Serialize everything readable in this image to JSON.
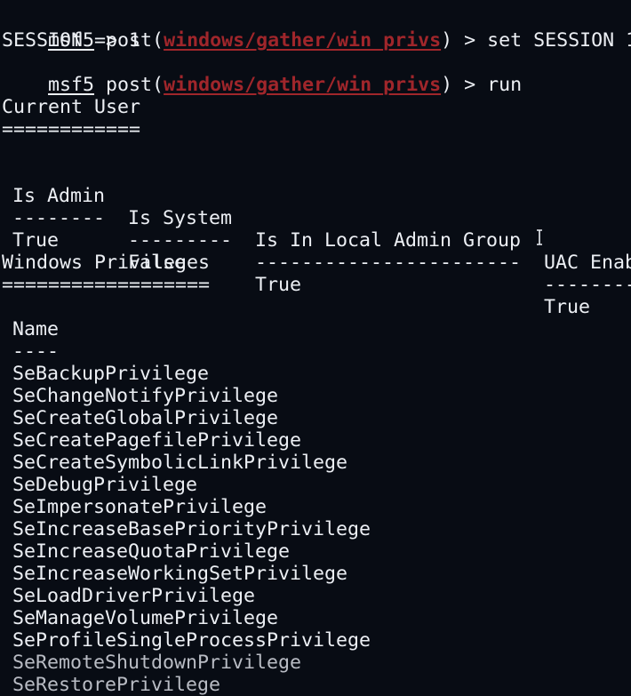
{
  "prompt": "msf5",
  "module_prefix": "post(",
  "module": "windows/gather/win_privs",
  "module_suffix": ")",
  "cmd1": " > set SESSION 1",
  "out1": "SESSION => 1",
  "cmd2": " > run",
  "current_user_title": "Current User",
  "current_user_rule": "============",
  "user_table": {
    "headers": [
      "Is Admin",
      "Is System",
      "Is In Local Admin Group",
      "UAC Enab"
    ],
    "separators": [
      "--------",
      "---------",
      "-----------------------",
      "--------"
    ],
    "row": [
      "True",
      "False",
      "True",
      "True"
    ]
  },
  "priv_title": "Windows Privileges",
  "priv_rule": "==================",
  "priv_header": "Name",
  "priv_sep": "----",
  "privileges": [
    "SeBackupPrivilege",
    "SeChangeNotifyPrivilege",
    "SeCreateGlobalPrivilege",
    "SeCreatePagefilePrivilege",
    "SeCreateSymbolicLinkPrivilege",
    "SeDebugPrivilege",
    "SeImpersonatePrivilege",
    "SeIncreaseBasePriorityPrivilege",
    "SeIncreaseQuotaPrivilege",
    "SeIncreaseWorkingSetPrivilege",
    "SeLoadDriverPrivilege",
    "SeManageVolumePrivilege",
    "SeProfileSingleProcessPrivilege",
    "SeRemoteShutdownPrivilege",
    "SeRestorePrivilege"
  ]
}
